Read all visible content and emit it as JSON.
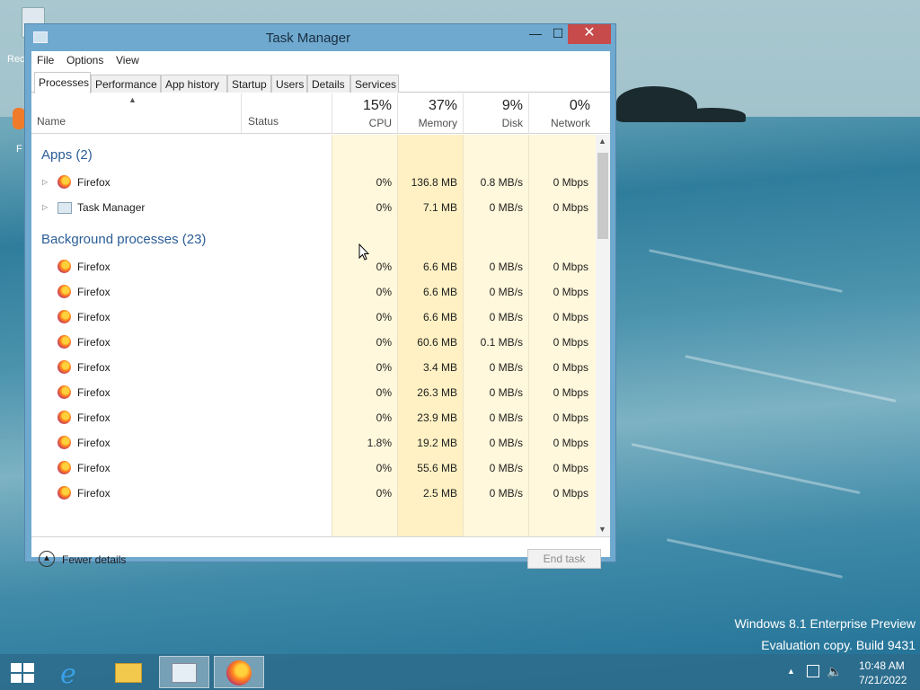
{
  "desktop": {
    "icon_labels": [
      "Rec",
      "F"
    ],
    "watermark_line1": "Windows 8.1 Enterprise Preview",
    "watermark_line2": "Evaluation copy. Build 9431"
  },
  "window": {
    "title": "Task Manager",
    "minimize_glyph": "—",
    "maximize_glyph": "☐",
    "close_glyph": "✕"
  },
  "menu": [
    "File",
    "Options",
    "View"
  ],
  "tabs": [
    "Processes",
    "Performance",
    "App history",
    "Startup",
    "Users",
    "Details",
    "Services"
  ],
  "columns": {
    "name": "Name",
    "status": "Status",
    "cpu": {
      "pct": "15%",
      "label": "CPU"
    },
    "memory": {
      "pct": "37%",
      "label": "Memory"
    },
    "disk": {
      "pct": "9%",
      "label": "Disk"
    },
    "network": {
      "pct": "0%",
      "label": "Network"
    }
  },
  "groups": {
    "apps": "Apps (2)",
    "background": "Background processes (23)"
  },
  "apps": [
    {
      "name": "Firefox",
      "cpu": "0%",
      "memory": "136.8 MB",
      "disk": "0.8 MB/s",
      "network": "0 Mbps"
    },
    {
      "name": "Task Manager",
      "cpu": "0%",
      "memory": "7.1 MB",
      "disk": "0 MB/s",
      "network": "0 Mbps"
    }
  ],
  "background": [
    {
      "name": "Firefox",
      "cpu": "0%",
      "memory": "6.6 MB",
      "disk": "0 MB/s",
      "network": "0 Mbps"
    },
    {
      "name": "Firefox",
      "cpu": "0%",
      "memory": "6.6 MB",
      "disk": "0 MB/s",
      "network": "0 Mbps"
    },
    {
      "name": "Firefox",
      "cpu": "0%",
      "memory": "6.6 MB",
      "disk": "0 MB/s",
      "network": "0 Mbps"
    },
    {
      "name": "Firefox",
      "cpu": "0%",
      "memory": "60.6 MB",
      "disk": "0.1 MB/s",
      "network": "0 Mbps"
    },
    {
      "name": "Firefox",
      "cpu": "0%",
      "memory": "3.4 MB",
      "disk": "0 MB/s",
      "network": "0 Mbps"
    },
    {
      "name": "Firefox",
      "cpu": "0%",
      "memory": "26.3 MB",
      "disk": "0 MB/s",
      "network": "0 Mbps"
    },
    {
      "name": "Firefox",
      "cpu": "0%",
      "memory": "23.9 MB",
      "disk": "0 MB/s",
      "network": "0 Mbps"
    },
    {
      "name": "Firefox",
      "cpu": "1.8%",
      "memory": "19.2 MB",
      "disk": "0 MB/s",
      "network": "0 Mbps"
    },
    {
      "name": "Firefox",
      "cpu": "0%",
      "memory": "55.6 MB",
      "disk": "0 MB/s",
      "network": "0 Mbps"
    },
    {
      "name": "Firefox",
      "cpu": "0%",
      "memory": "2.5 MB",
      "disk": "0 MB/s",
      "network": "0 Mbps"
    }
  ],
  "footer": {
    "fewer_details": "Fewer details",
    "end_task": "End task"
  },
  "taskbar": {
    "apps": [
      "start-icon",
      "internet-explorer-icon",
      "file-explorer-icon",
      "task-manager-icon",
      "firefox-icon"
    ],
    "time": "10:48 AM",
    "date": "7/21/2022"
  },
  "colors": {
    "heat_light": "#fff8dc",
    "heat_mid": "#fff0c2",
    "group_blue": "#2b5d97",
    "close_red": "#c74b4b"
  }
}
